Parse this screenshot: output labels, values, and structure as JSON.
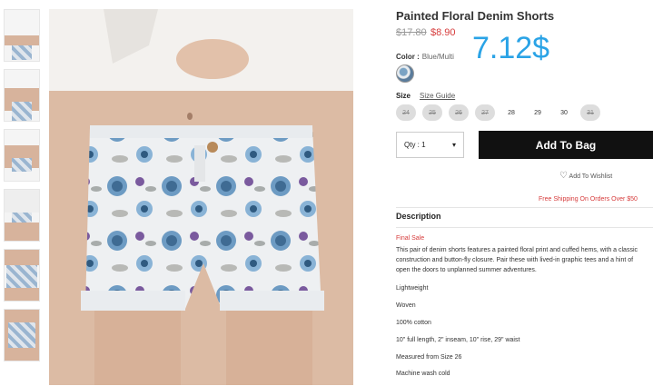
{
  "product": {
    "title": "Painted Floral Denim Shorts",
    "price_original": "$17.80",
    "price_sale": "$8.90",
    "overlay_price": "7.12$",
    "color_label": "Color :",
    "color_value": "Blue/Multi",
    "size_label": "Size",
    "size_guide": "Size Guide",
    "sizes": [
      {
        "label": "24",
        "available": false
      },
      {
        "label": "25",
        "available": false
      },
      {
        "label": "26",
        "available": false
      },
      {
        "label": "27",
        "available": false
      },
      {
        "label": "28",
        "available": true
      },
      {
        "label": "29",
        "available": true
      },
      {
        "label": "30",
        "available": true
      },
      {
        "label": "31",
        "available": false
      }
    ],
    "qty_label": "Qty : 1",
    "add_to_bag": "Add To Bag",
    "wishlist": "Add To Wishlist",
    "shipping": "Free Shipping On Orders Over $50",
    "description_heading": "Description",
    "final_sale": "Final Sale",
    "description": [
      "This pair of denim shorts features a painted floral print and cuffed hems, with a classic",
      "construction and button-fly closure. Pair these with lived-in graphic tees and a hint of",
      "open the doors to unplanned summer adventures."
    ],
    "specs": [
      "Lightweight",
      "Woven",
      "100% cotton",
      "10\" full length, 2\" inseam, 10\" rise, 29\" waist",
      "Measured from Size 26",
      "Machine wash cold"
    ]
  },
  "colors": {
    "sale": "#d63b3b",
    "overlay": "#2aa3e6",
    "button": "#111111"
  }
}
